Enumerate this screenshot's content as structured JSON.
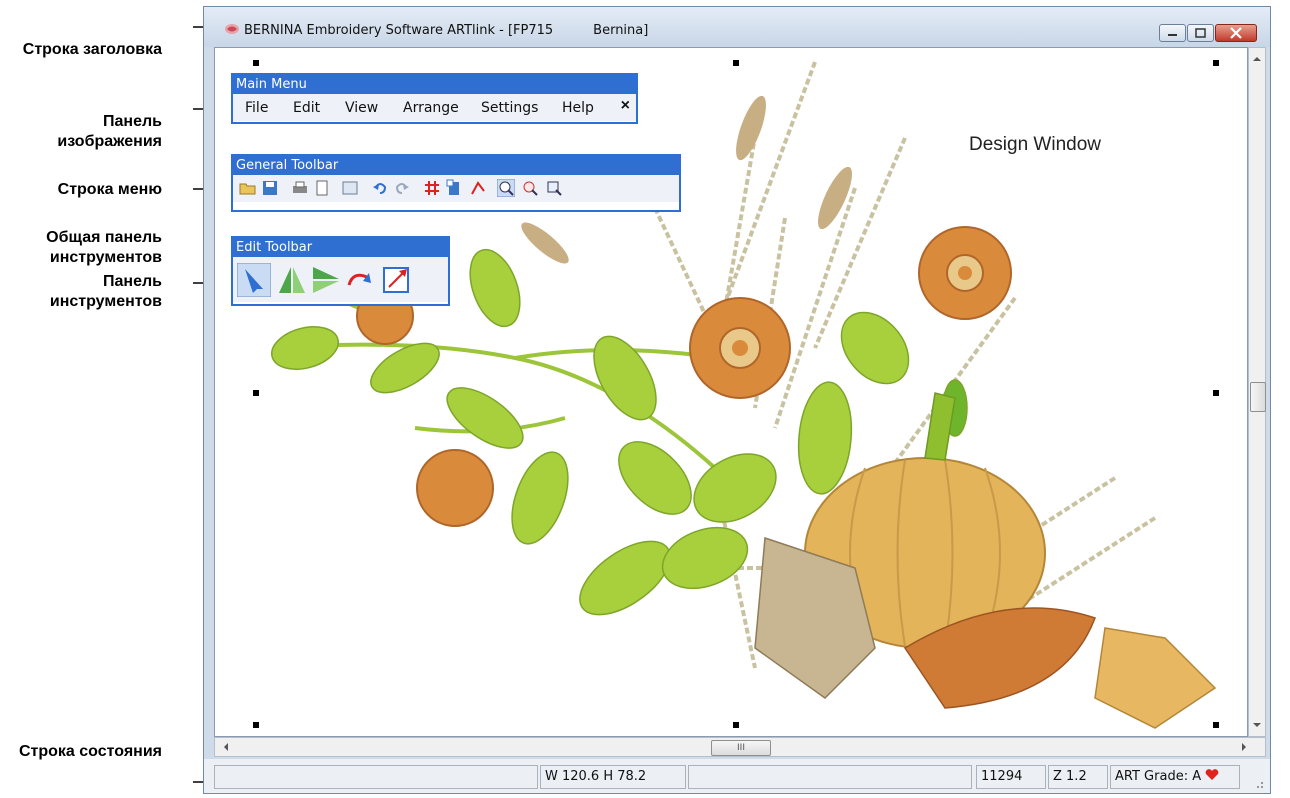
{
  "annotations": [
    "Строка заголовка",
    "Панель изображения",
    "Строка меню",
    "Общая панель инструментов",
    "Панель инструментов",
    "Строка состояния"
  ],
  "window": {
    "title_app": "BERNINA Embroidery Software ARTlink - [FP715",
    "title_doc": "Bernina]"
  },
  "main_menu": {
    "title": "Main Menu",
    "items": [
      "File",
      "Edit",
      "View",
      "Arrange",
      "Settings",
      "Help"
    ],
    "close": "×"
  },
  "general_toolbar": {
    "title": "General Toolbar",
    "buttons": [
      "open-icon",
      "save-icon",
      "print-icon",
      "print-preview-icon",
      "hoop-icon",
      "undo-icon",
      "redo-icon",
      "grid-icon",
      "show-design-icon",
      "stitch-icon",
      "zoom-icon",
      "zoom-1-1-icon",
      "zoom-box-icon"
    ]
  },
  "edit_toolbar": {
    "title": "Edit Toolbar",
    "buttons": [
      "select-arrow-icon",
      "mirror-vertical-icon",
      "mirror-horizontal-icon",
      "rotate-icon",
      "scale-icon"
    ]
  },
  "design_window_label": "Design Window",
  "status": {
    "dimensions": "W 120.6 H  78.2",
    "stitch_count": "11294",
    "zoom": "Z 1.2",
    "art_grade": "ART Grade: A"
  },
  "hscroll_thumb": "III",
  "colors": {
    "toolbar_accent": "#2f6fd1",
    "leaf_green": "#9cc53a",
    "flower_orange": "#d98a3a",
    "pumpkin": "#e3b45a"
  }
}
